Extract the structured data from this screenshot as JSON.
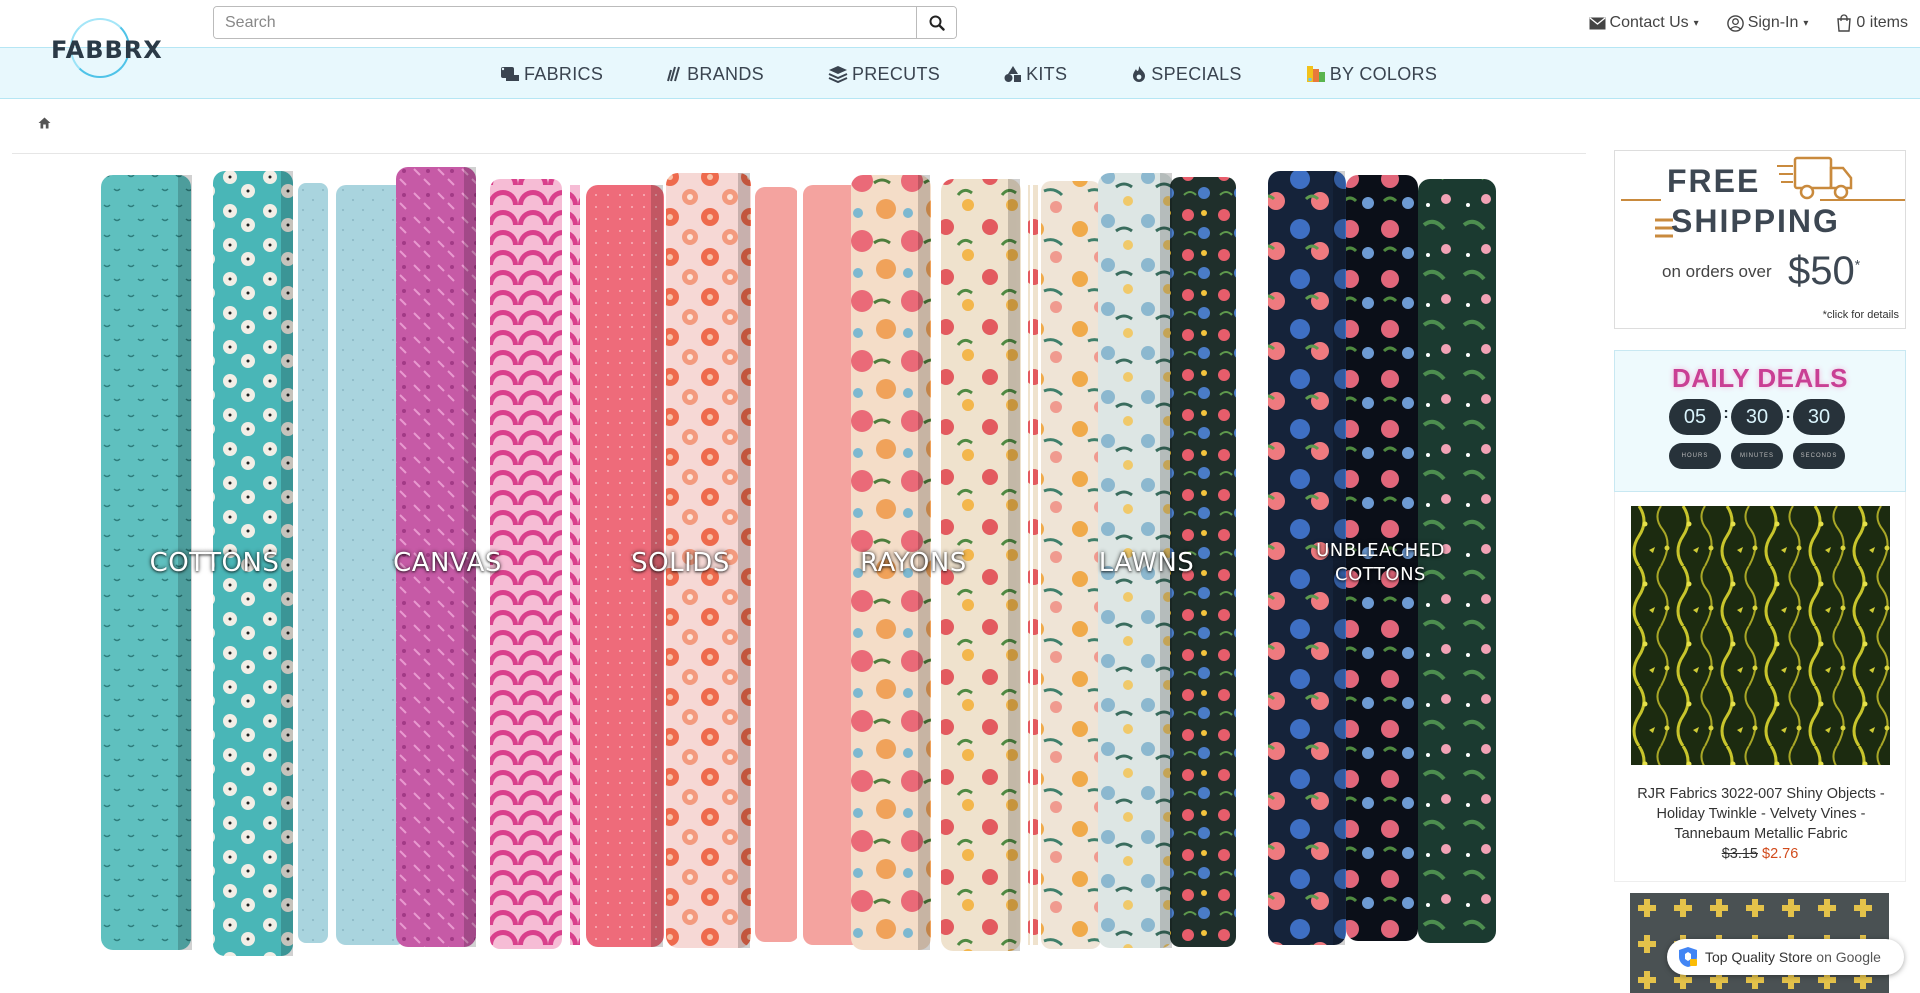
{
  "header": {
    "logo_text": "FABBRX",
    "search_placeholder": "Search",
    "contact_label": "Contact Us",
    "signin_label": "Sign-In",
    "cart_label": "0 items"
  },
  "nav": {
    "items": [
      {
        "label": "FABRICS",
        "icon": "fabric-roll-icon"
      },
      {
        "label": "BRANDS",
        "icon": "brands-icon"
      },
      {
        "label": "PRECUTS",
        "icon": "layers-icon"
      },
      {
        "label": "KITS",
        "icon": "kits-icon"
      },
      {
        "label": "SPECIALS",
        "icon": "fire-icon"
      },
      {
        "label": "BY COLORS",
        "icon": "color-swatch-icon"
      }
    ]
  },
  "breadcrumb": {
    "icon": "home-icon"
  },
  "hero": {
    "categories": [
      "COTTONS",
      "CANVAS",
      "SOLIDS",
      "RAYONS",
      "LAWNS",
      "UNBLEACHED",
      "COTTONS"
    ]
  },
  "shipping": {
    "line1": "FREE",
    "line2": "SHIPPING",
    "on_orders": "on orders over",
    "amount": "$50",
    "asterisk": "*",
    "note": "*click for details"
  },
  "deals": {
    "title": "DAILY DEALS",
    "hours": "05",
    "minutes": "30",
    "seconds": "30",
    "hours_label": "HOURS",
    "minutes_label": "MINUTES",
    "seconds_label": "SECONDS"
  },
  "product": {
    "name": "RJR Fabrics 3022-007 Shiny Objects - Holiday Twinkle - Velvety Vines - Tannebaum Metallic Fabric",
    "old_price": "$3.15",
    "new_price": "$2.76"
  },
  "google_badge": {
    "label": "Top Quality Store",
    "suffix": "on Google"
  },
  "colors": {
    "nav_bg": "#e8f8fd",
    "accent_pink": "#c93f94",
    "sale_red": "#d14b1c"
  }
}
